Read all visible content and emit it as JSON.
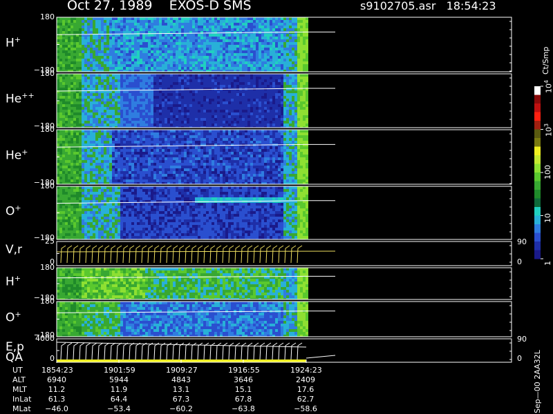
{
  "header": {
    "date": "Oct 27, 1989",
    "instrument": "EXOS-D SMS",
    "filename": "s9102705.asr",
    "time": "18:54:23"
  },
  "panels": [
    {
      "label_main": "H",
      "label_sup": "+",
      "ytop": "180",
      "ybot": "−180",
      "scheme": "h1"
    },
    {
      "label_main": "He",
      "label_sup": "++",
      "ytop": "180",
      "ybot": "−180",
      "scheme": "he2"
    },
    {
      "label_main": "He",
      "label_sup": "+",
      "ytop": "180",
      "ybot": "−180",
      "scheme": "he1"
    },
    {
      "label_main": "O",
      "label_sup": "+",
      "ytop": "180",
      "ybot": "−180",
      "scheme": "o1"
    },
    {
      "label_main": "V,r",
      "label_sup": "",
      "ytop": "25",
      "ybot": "0",
      "scheme": "line",
      "rtop": "90",
      "rbot": "0"
    },
    {
      "label_main": "H",
      "label_sup": "+",
      "ytop": "180",
      "ybot": "−180",
      "scheme": "h2"
    },
    {
      "label_main": "O",
      "label_sup": "+",
      "ytop": "180",
      "ybot": "−180",
      "scheme": "o2"
    },
    {
      "label_main": "E,p",
      "label_sup": "",
      "label_extra": "QA",
      "ytop": "4000",
      "ybot": "0",
      "scheme": "line2",
      "rtop": "90",
      "rbot": "0"
    }
  ],
  "colorbar": {
    "unit_label": "Ct/Smp",
    "ticks": [
      {
        "label": "10",
        "sup": "4",
        "value": 10000
      },
      {
        "label": "10",
        "sup": "3",
        "value": 1000
      },
      {
        "label": "100",
        "sup": "",
        "value": 100
      },
      {
        "label": "10",
        "sup": "",
        "value": 10
      },
      {
        "label": "1",
        "sup": "",
        "value": 1
      }
    ],
    "colors": [
      "#1a1a8a",
      "#1e2fa8",
      "#2a4fcf",
      "#2f7de0",
      "#28b0d8",
      "#20d0c0",
      "#0e6a3a",
      "#1f8a2a",
      "#38a832",
      "#5ac82e",
      "#8ee032",
      "#c4e830",
      "#f0f020",
      "#7a7a10",
      "#5a5a10",
      "#a02010",
      "#ff2010",
      "#c01010",
      "#8a0a0a",
      "#ffffff"
    ]
  },
  "ephemeris": {
    "rows": [
      {
        "name": "UT",
        "values": [
          "1854:23",
          "1901:59",
          "1909:27",
          "1916:55",
          "1924:23"
        ]
      },
      {
        "name": "ALT",
        "values": [
          "6940",
          "5944",
          "4843",
          "3646",
          "2409"
        ]
      },
      {
        "name": "MLT",
        "values": [
          "11.2",
          "11.9",
          "13.1",
          "15.1",
          "17.6"
        ]
      },
      {
        "name": "InLat",
        "values": [
          "61.3",
          "64.4",
          "67.3",
          "67.8",
          "62.7"
        ]
      },
      {
        "name": "MLat",
        "values": [
          "−46.0",
          "−53.4",
          "−60.2",
          "−63.8",
          "−58.6"
        ]
      }
    ]
  },
  "footer_vertical": "Sep—00  2AA32L",
  "chart_data": {
    "type": "heatmap",
    "title": "Oct 27, 1989   EXOS-D SMS",
    "x": [
      "1854:23",
      "1901:59",
      "1909:27",
      "1916:55",
      "1924:23"
    ],
    "ylim": [
      -180,
      180
    ],
    "series": [
      {
        "name": "H+",
        "ylim": [
          -180,
          180
        ]
      },
      {
        "name": "He++",
        "ylim": [
          -180,
          180
        ]
      },
      {
        "name": "He+",
        "ylim": [
          -180,
          180
        ]
      },
      {
        "name": "O+",
        "ylim": [
          -180,
          180
        ]
      },
      {
        "name": "V,r",
        "ylim": [
          0,
          25
        ],
        "right_ylim": [
          0,
          90
        ]
      },
      {
        "name": "H+",
        "ylim": [
          -180,
          180
        ]
      },
      {
        "name": "O+",
        "ylim": [
          -180,
          180
        ]
      },
      {
        "name": "E,p",
        "ylim": [
          0,
          4000
        ],
        "right_ylim": [
          0,
          90
        ]
      }
    ],
    "colorbar_range": [
      1,
      10000
    ],
    "colorbar_unit": "Ct/Smp"
  }
}
